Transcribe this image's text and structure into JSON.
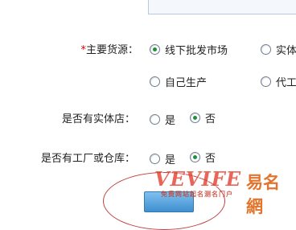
{
  "form": {
    "main_source": {
      "required_mark": "*",
      "label": "主要货源：",
      "options": [
        {
          "label": "线下批发市场",
          "checked": true
        },
        {
          "label": "实体",
          "checked": false
        },
        {
          "label": "自己生产",
          "checked": false
        },
        {
          "label": "代工",
          "checked": false
        }
      ]
    },
    "has_store": {
      "label": "是否有实体店：",
      "options": [
        {
          "label": "是",
          "checked": false
        },
        {
          "label": "否",
          "checked": true
        }
      ]
    },
    "has_factory": {
      "label": "是否有工厂或仓库：",
      "options": [
        {
          "label": "是",
          "checked": false
        },
        {
          "label": "否",
          "checked": true
        }
      ]
    }
  },
  "watermark": {
    "brand": "VEVIFE",
    "name": "易名網",
    "tagline": "免费网站起名测名门户"
  },
  "colors": {
    "required": "#e00000",
    "radio_checked": "#1f8f3a",
    "watermark": "#e23a2a"
  }
}
